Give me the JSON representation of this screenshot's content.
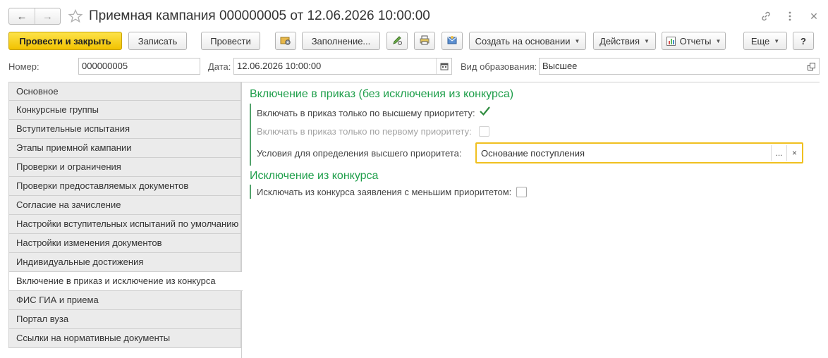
{
  "window": {
    "title": "Приемная кампания 000000005 от 12.06.2026 10:00:00"
  },
  "toolbar": {
    "post_close_label": "Провести и закрыть",
    "save_label": "Записать",
    "post_label": "Провести",
    "fill_label": "Заполнение...",
    "create_based_label": "Создать на основании",
    "actions_label": "Действия",
    "reports_label": "Отчеты",
    "more_label": "Еще",
    "help_label": "?"
  },
  "header": {
    "number_label": "Номер:",
    "number_value": "000000005",
    "date_label": "Дата:",
    "date_value": "12.06.2026 10:00:00",
    "edu_type_label": "Вид образования:",
    "edu_type_value": "Высшее"
  },
  "sidebar": {
    "items": [
      {
        "label": "Основное",
        "active": false
      },
      {
        "label": "Конкурсные группы",
        "active": false
      },
      {
        "label": "Вступительные испытания",
        "active": false
      },
      {
        "label": "Этапы приемной кампании",
        "active": false
      },
      {
        "label": "Проверки и ограничения",
        "active": false
      },
      {
        "label": "Проверки предоставляемых документов",
        "active": false
      },
      {
        "label": "Согласие на зачисление",
        "active": false
      },
      {
        "label": "Настройки вступительных испытаний по умолчанию",
        "active": false
      },
      {
        "label": "Настройки изменения документов",
        "active": false
      },
      {
        "label": "Индивидуальные достижения",
        "active": false
      },
      {
        "label": "Включение в приказ и исключение из конкурса",
        "active": true
      },
      {
        "label": "ФИС ГИА и приема",
        "active": false
      },
      {
        "label": "Портал вуза",
        "active": false
      },
      {
        "label": "Ссылки на нормативные документы",
        "active": false
      }
    ]
  },
  "main": {
    "section1": {
      "title": "Включение в приказ (без исключения из конкурса)",
      "highest_priority_label": "Включать в приказ только по высшему приоритету:",
      "highest_priority_checked": true,
      "first_priority_label": "Включать в приказ только по первому приоритету:",
      "first_priority_checked": false,
      "conditions_label": "Условия для определения высшего приоритета:",
      "conditions_value": "Основание поступления"
    },
    "section2": {
      "title": "Исключение из конкурса",
      "exclude_label": "Исключать из конкурса заявления с меньшим приоритетом:",
      "exclude_checked": false
    }
  },
  "colors": {
    "accent_green": "#1e9e4a",
    "primary_button": "#f2c200",
    "focus_border": "#f0c020"
  }
}
